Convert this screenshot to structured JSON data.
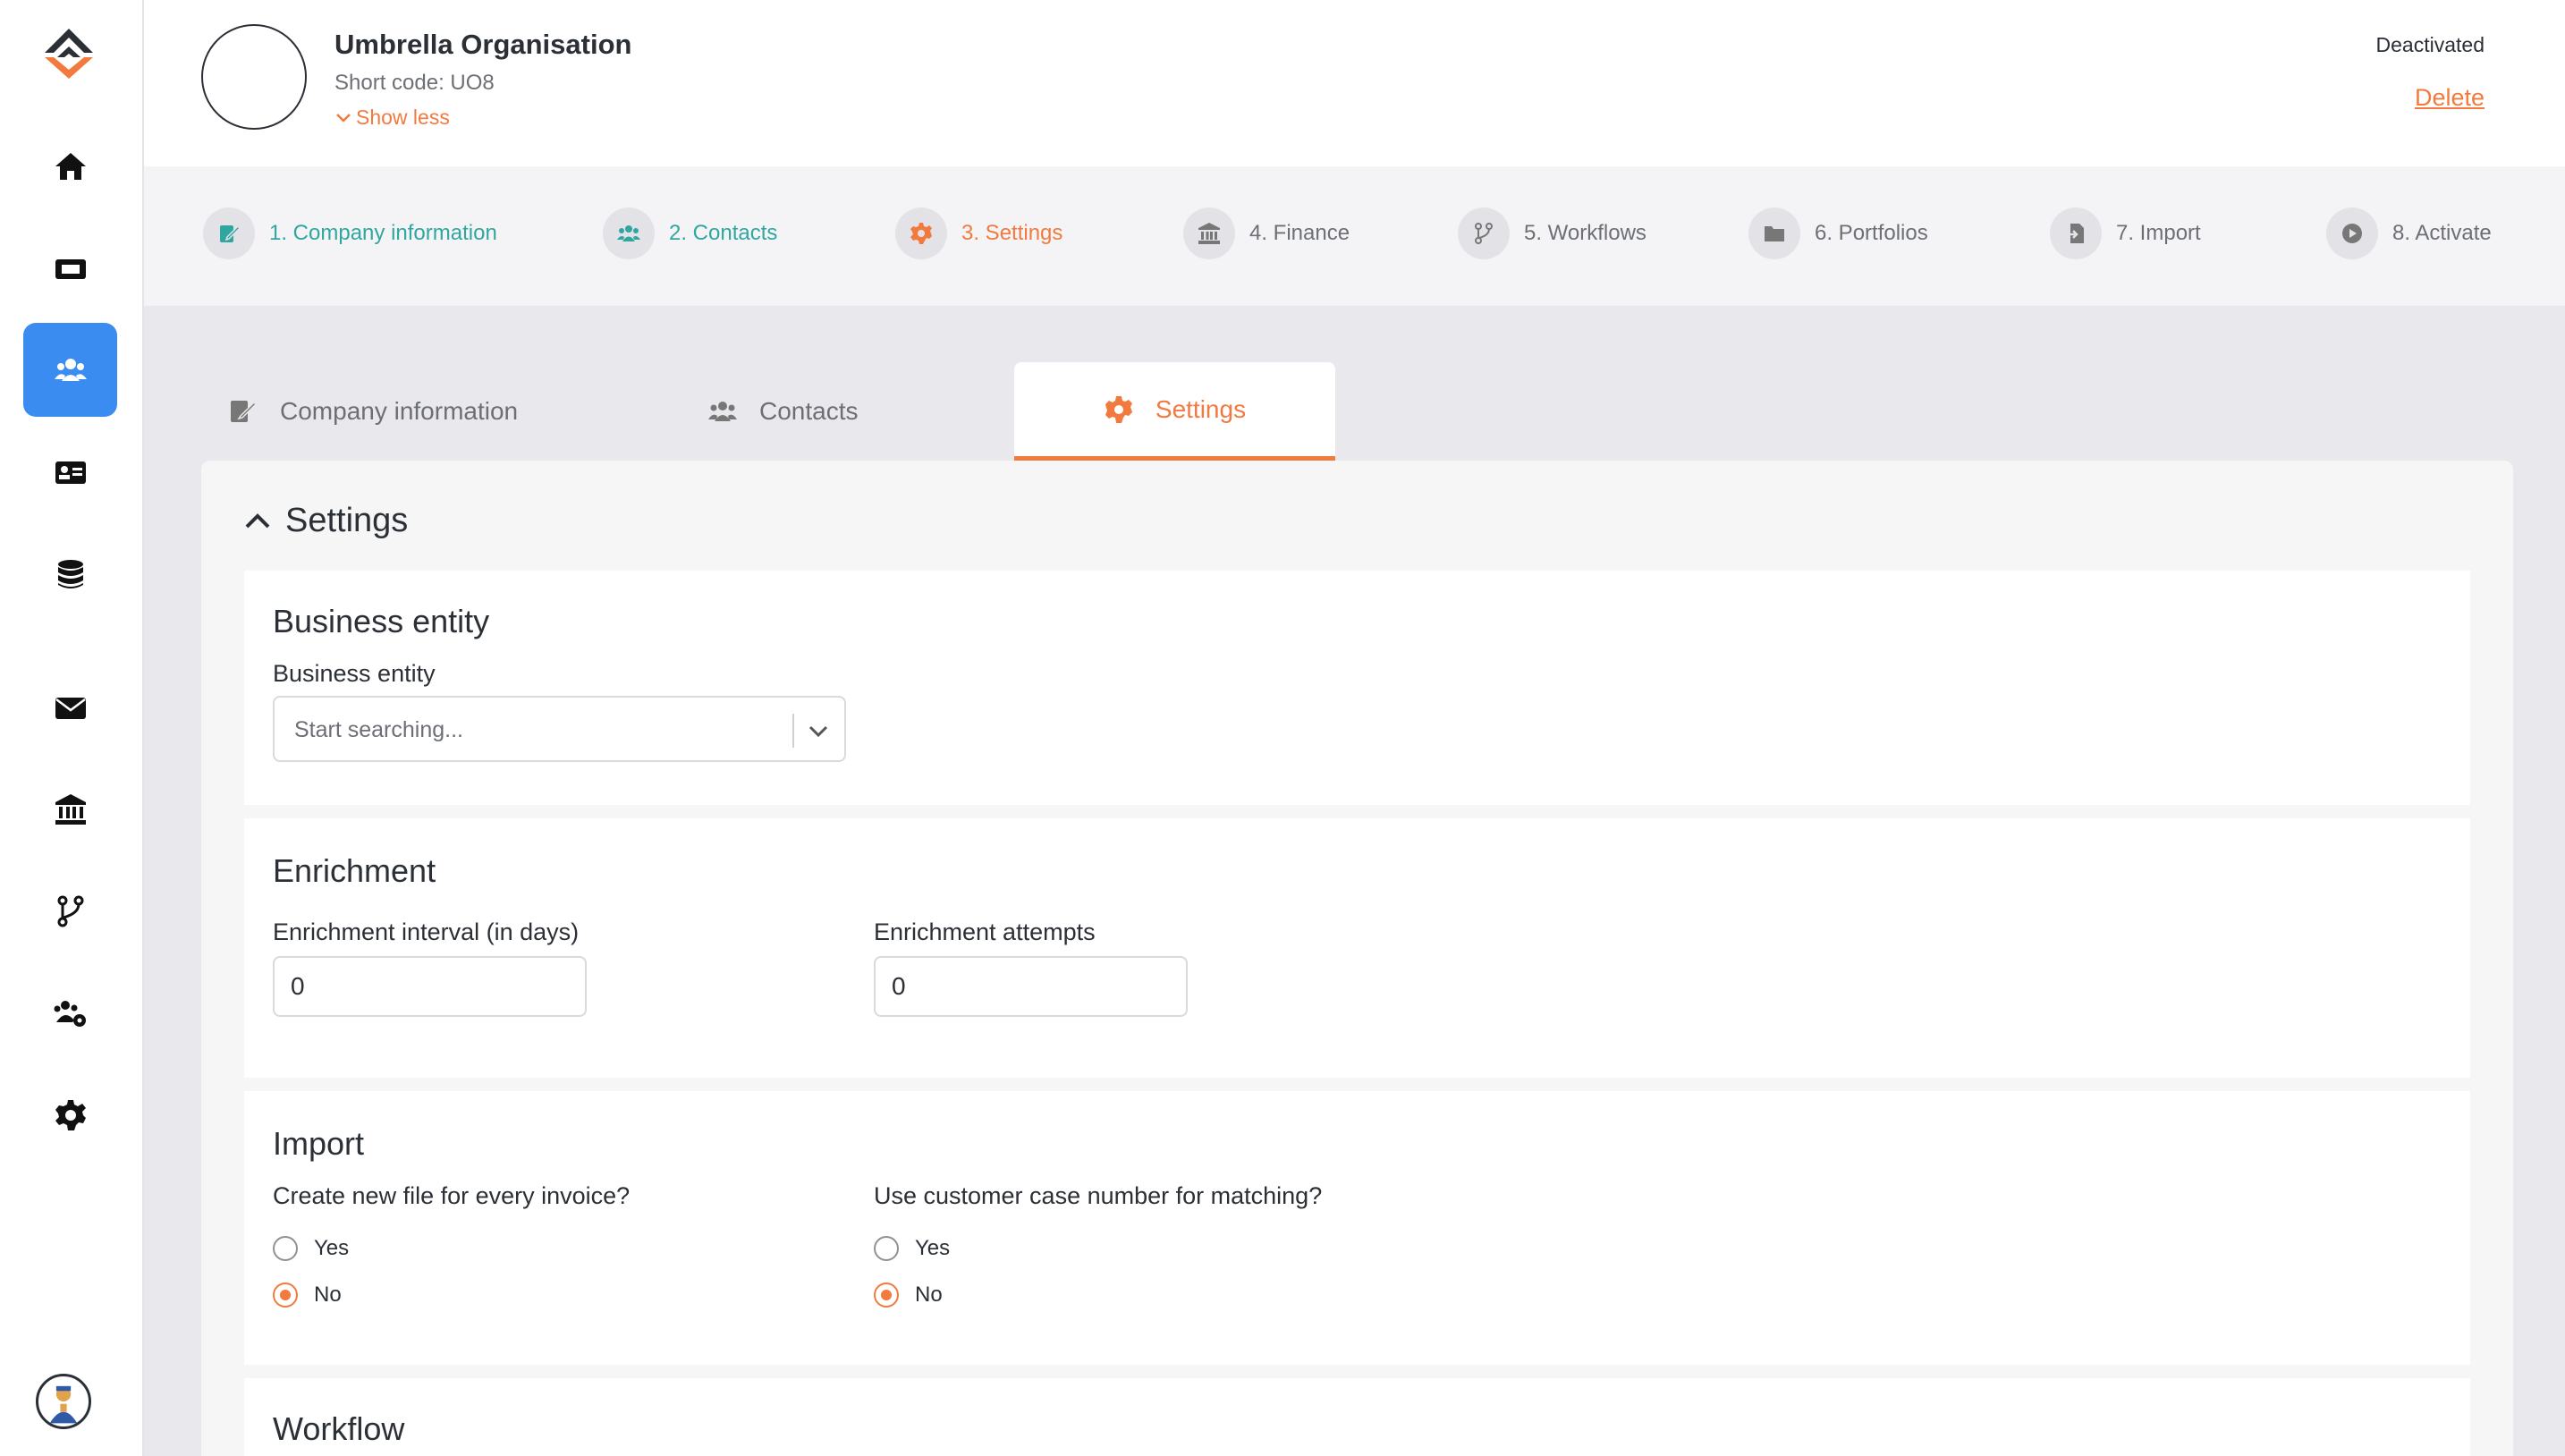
{
  "org": {
    "name": "Umbrella Organisation",
    "short_code": "Short code: UO8",
    "show_less": "Show less",
    "status": "Deactivated",
    "delete_label": "Delete"
  },
  "rail": {
    "items": [
      "home-icon",
      "ticket-icon",
      "users-icon",
      "id-card-icon",
      "database-icon",
      "mail-icon",
      "bank-icon",
      "branch-icon",
      "users-gear-icon",
      "gear-icon"
    ],
    "active": "users-icon"
  },
  "steps": [
    {
      "label": "1. Company information",
      "state": "done"
    },
    {
      "label": "2. Contacts",
      "state": "done"
    },
    {
      "label": "3. Settings",
      "state": "current"
    },
    {
      "label": "4. Finance",
      "state": "todo"
    },
    {
      "label": "5. Workflows",
      "state": "todo"
    },
    {
      "label": "6. Portfolios",
      "state": "todo"
    },
    {
      "label": "7. Import",
      "state": "todo"
    },
    {
      "label": "8. Activate",
      "state": "todo"
    }
  ],
  "tabs": [
    {
      "label": "Company information"
    },
    {
      "label": "Contacts"
    },
    {
      "label": "Settings",
      "active": true
    }
  ],
  "panel": {
    "title": "Settings",
    "business": {
      "title": "Business entity",
      "label": "Business entity",
      "placeholder": "Start searching..."
    },
    "enrichment": {
      "title": "Enrichment",
      "interval_label": "Enrichment interval (in days)",
      "interval_value": "0",
      "attempts_label": "Enrichment attempts",
      "attempts_value": "0"
    },
    "import": {
      "title": "Import",
      "q1": "Create new file for every invoice?",
      "q2": "Use customer case number for matching?",
      "yes": "Yes",
      "no": "No",
      "q1_value": "No",
      "q2_value": "No"
    },
    "workflow": {
      "title": "Workflow"
    }
  },
  "colors": {
    "accent": "#f27a3e",
    "done": "#2fa7a0",
    "active_rail": "#3b8cf0"
  }
}
